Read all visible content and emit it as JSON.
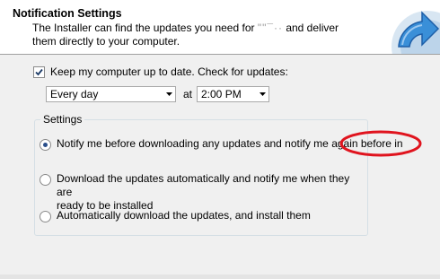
{
  "header": {
    "title": "Notification Settings",
    "description_line1_prefix": "The Installer can find the updates you need for",
    "description_line1_redacted": "\"\"¯··",
    "description_line1_suffix": "and deliver",
    "description_line2": "them directly to your computer."
  },
  "keep_updated": {
    "checked": true,
    "label": "Keep my computer up to date. Check for updates:"
  },
  "schedule": {
    "frequency": "Every day",
    "at_label": "at",
    "time": "2:00 PM"
  },
  "settings_group": {
    "title": "Settings",
    "options": [
      {
        "label": "Notify me before downloading any updates and notify me again before in",
        "selected": true
      },
      {
        "label_line1": "Download the updates automatically and notify me when they are",
        "label_line2": "ready to be installed",
        "selected": false
      },
      {
        "label": "Automatically download the updates, and install them",
        "selected": false
      }
    ]
  },
  "icons": {
    "header_art": "update-arrow-icon",
    "dropdown": "chevron-down-icon",
    "check": "checkmark-icon"
  },
  "colors": {
    "annotation": "#e0141e",
    "header_art": "#3a8fd8",
    "radio_dot": "#2a4e8a"
  }
}
